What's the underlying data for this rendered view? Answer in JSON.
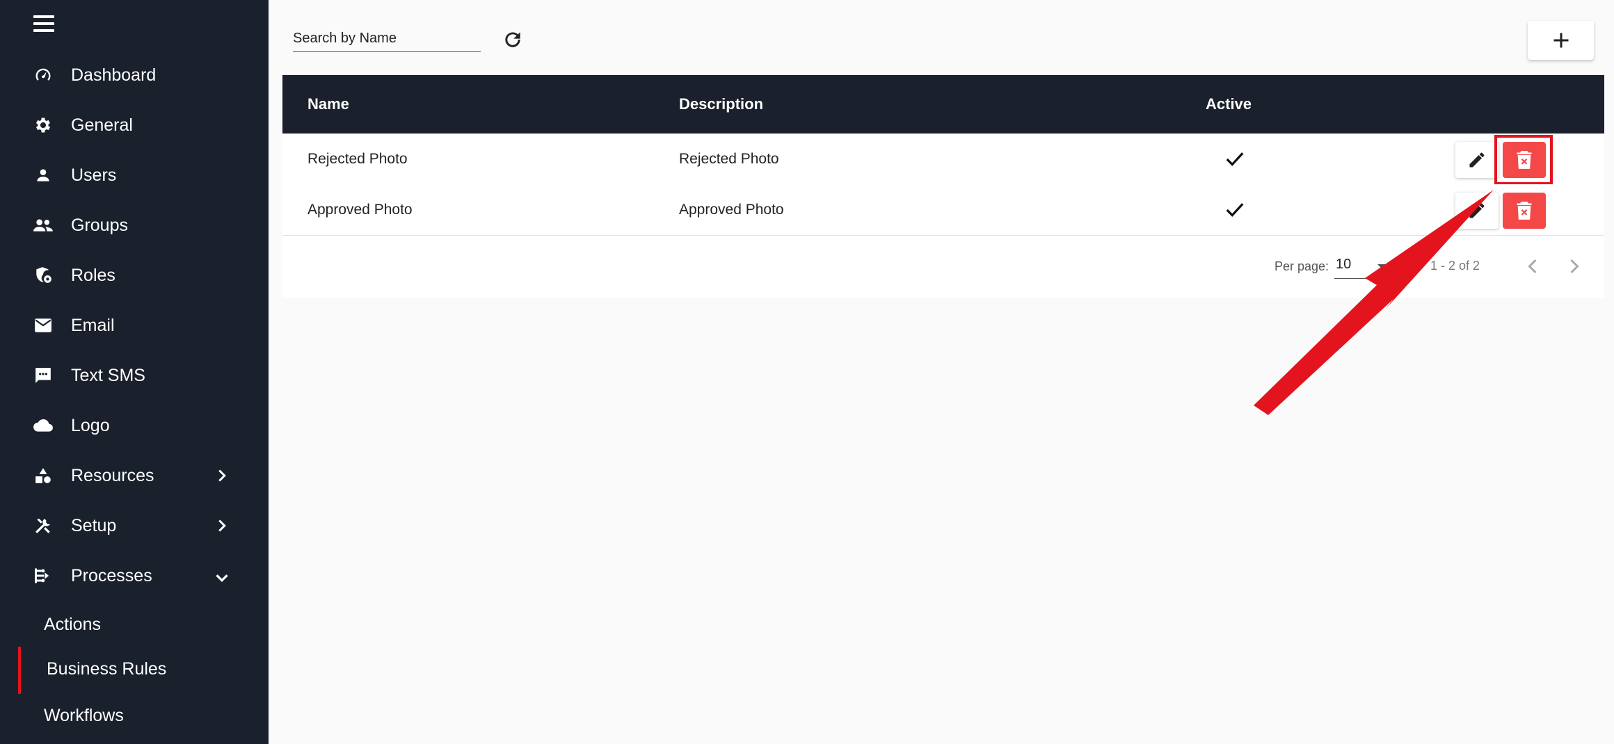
{
  "sidebar": {
    "menu_icon": "hamburger-menu-icon",
    "items": [
      {
        "label": "Dashboard",
        "icon": "speedometer-icon"
      },
      {
        "label": "General",
        "icon": "gear-icon"
      },
      {
        "label": "Users",
        "icon": "person-icon"
      },
      {
        "label": "Groups",
        "icon": "people-icon"
      },
      {
        "label": "Roles",
        "icon": "shield-gear-icon"
      },
      {
        "label": "Email",
        "icon": "envelope-icon"
      },
      {
        "label": "Text SMS",
        "icon": "chat-bubble-icon"
      },
      {
        "label": "Logo",
        "icon": "cloud-icon"
      },
      {
        "label": "Resources",
        "icon": "shapes-icon",
        "expand": "chevron-right-icon"
      },
      {
        "label": "Setup",
        "icon": "tools-icon",
        "expand": "chevron-right-icon"
      },
      {
        "label": "Processes",
        "icon": "process-flow-icon",
        "expand": "chevron-down-icon"
      }
    ],
    "sub_items": [
      {
        "label": "Actions"
      },
      {
        "label": "Business Rules",
        "active": true
      },
      {
        "label": "Workflows"
      }
    ]
  },
  "search": {
    "placeholder": "Search by Name",
    "value": ""
  },
  "toolbar": {
    "refresh_icon": "refresh-icon",
    "add_icon": "plus-icon"
  },
  "table": {
    "headers": [
      "Name",
      "Description",
      "Active"
    ],
    "rows": [
      {
        "name": "Rejected Photo",
        "description": "Rejected Photo",
        "active": true
      },
      {
        "name": "Approved Photo",
        "description": "Approved Photo",
        "active": true
      }
    ]
  },
  "pagination": {
    "per_page_label": "Per page:",
    "per_page_value": "10",
    "range_text": "1 - 2 of 2"
  },
  "colors": {
    "sidebar_bg": "#1a202c",
    "header_bg": "#1a202c",
    "delete_red": "#f44848",
    "annotation_red": "#e3141e",
    "active_indicator": "#e3141e"
  }
}
